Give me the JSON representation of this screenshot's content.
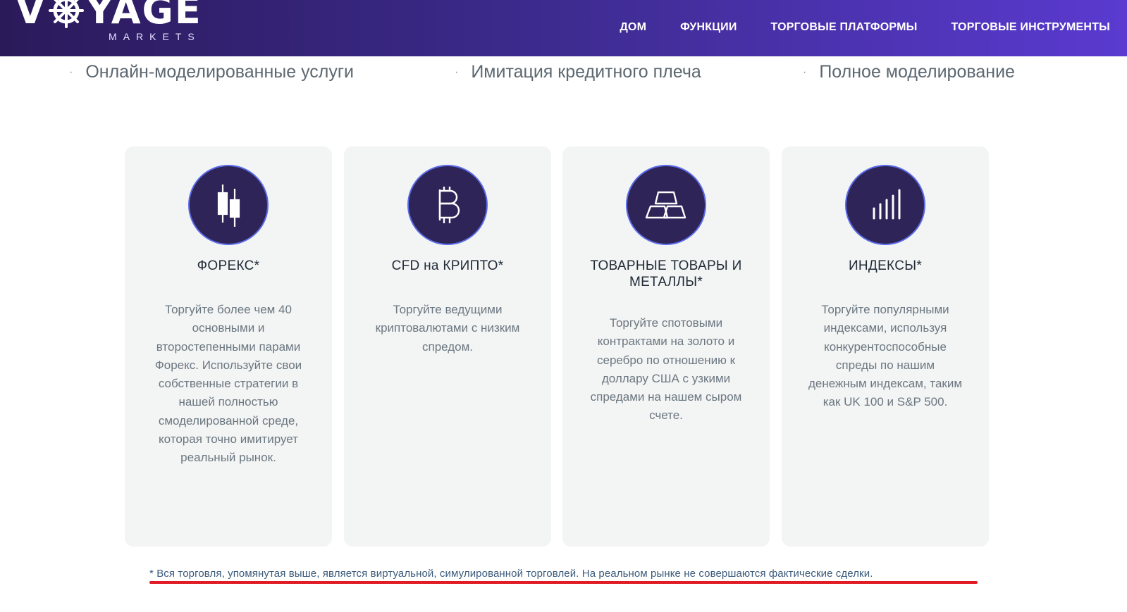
{
  "header": {
    "logo_text": "VOYAGE",
    "logo_sub": "MARKETS",
    "nav": [
      {
        "label": "ДОМ"
      },
      {
        "label": "ФУНКЦИИ"
      },
      {
        "label": "ТОРГОВЫЕ ПЛАТФОРМЫ"
      },
      {
        "label": "ТОРГОВЫЕ ИНСТРУМЕНТЫ"
      }
    ]
  },
  "features": [
    {
      "label": "Онлайн-моделированные услуги"
    },
    {
      "label": "Имитация кредитного плеча"
    },
    {
      "label": "Полное моделирование"
    }
  ],
  "cards": [
    {
      "icon": "candlestick-icon",
      "title": "ФОРЕКС*",
      "description": "Торгуйте более чем 40 основными и второстепенными парами Форекс. Используйте свои собственные стратегии в нашей полностью смоделированной среде, которая точно имитирует реальный рынок."
    },
    {
      "icon": "bitcoin-icon",
      "title": "CFD на КРИПТО*",
      "description": "Торгуйте ведущими криптовалютами с низким спредом."
    },
    {
      "icon": "gold-bars-icon",
      "title": "ТОВАРНЫЕ ТОВАРЫ И МЕТАЛЛЫ*",
      "description": "Торгуйте спотовыми контрактами на золото и серебро по отношению к доллару США с узкими спредами на нашем сыром счете."
    },
    {
      "icon": "bar-chart-icon",
      "title": "ИНДЕКСЫ*",
      "description": "Торгуйте популярными индексами, используя конкурентоспособные спреды по нашим денежным индексам, таким как UK 100 и S&P 500."
    }
  ],
  "disclaimer": "* Вся торговля, упомянутая выше, является виртуальной, симулированной торговлей. На реальном рынке не совершаются фактические сделки.",
  "colors": {
    "header_start": "#2b1a5a",
    "header_end": "#5a3ad0",
    "icon_circle": "#2e2457",
    "icon_ring": "#5b6be8",
    "underline": "#e01b24"
  }
}
